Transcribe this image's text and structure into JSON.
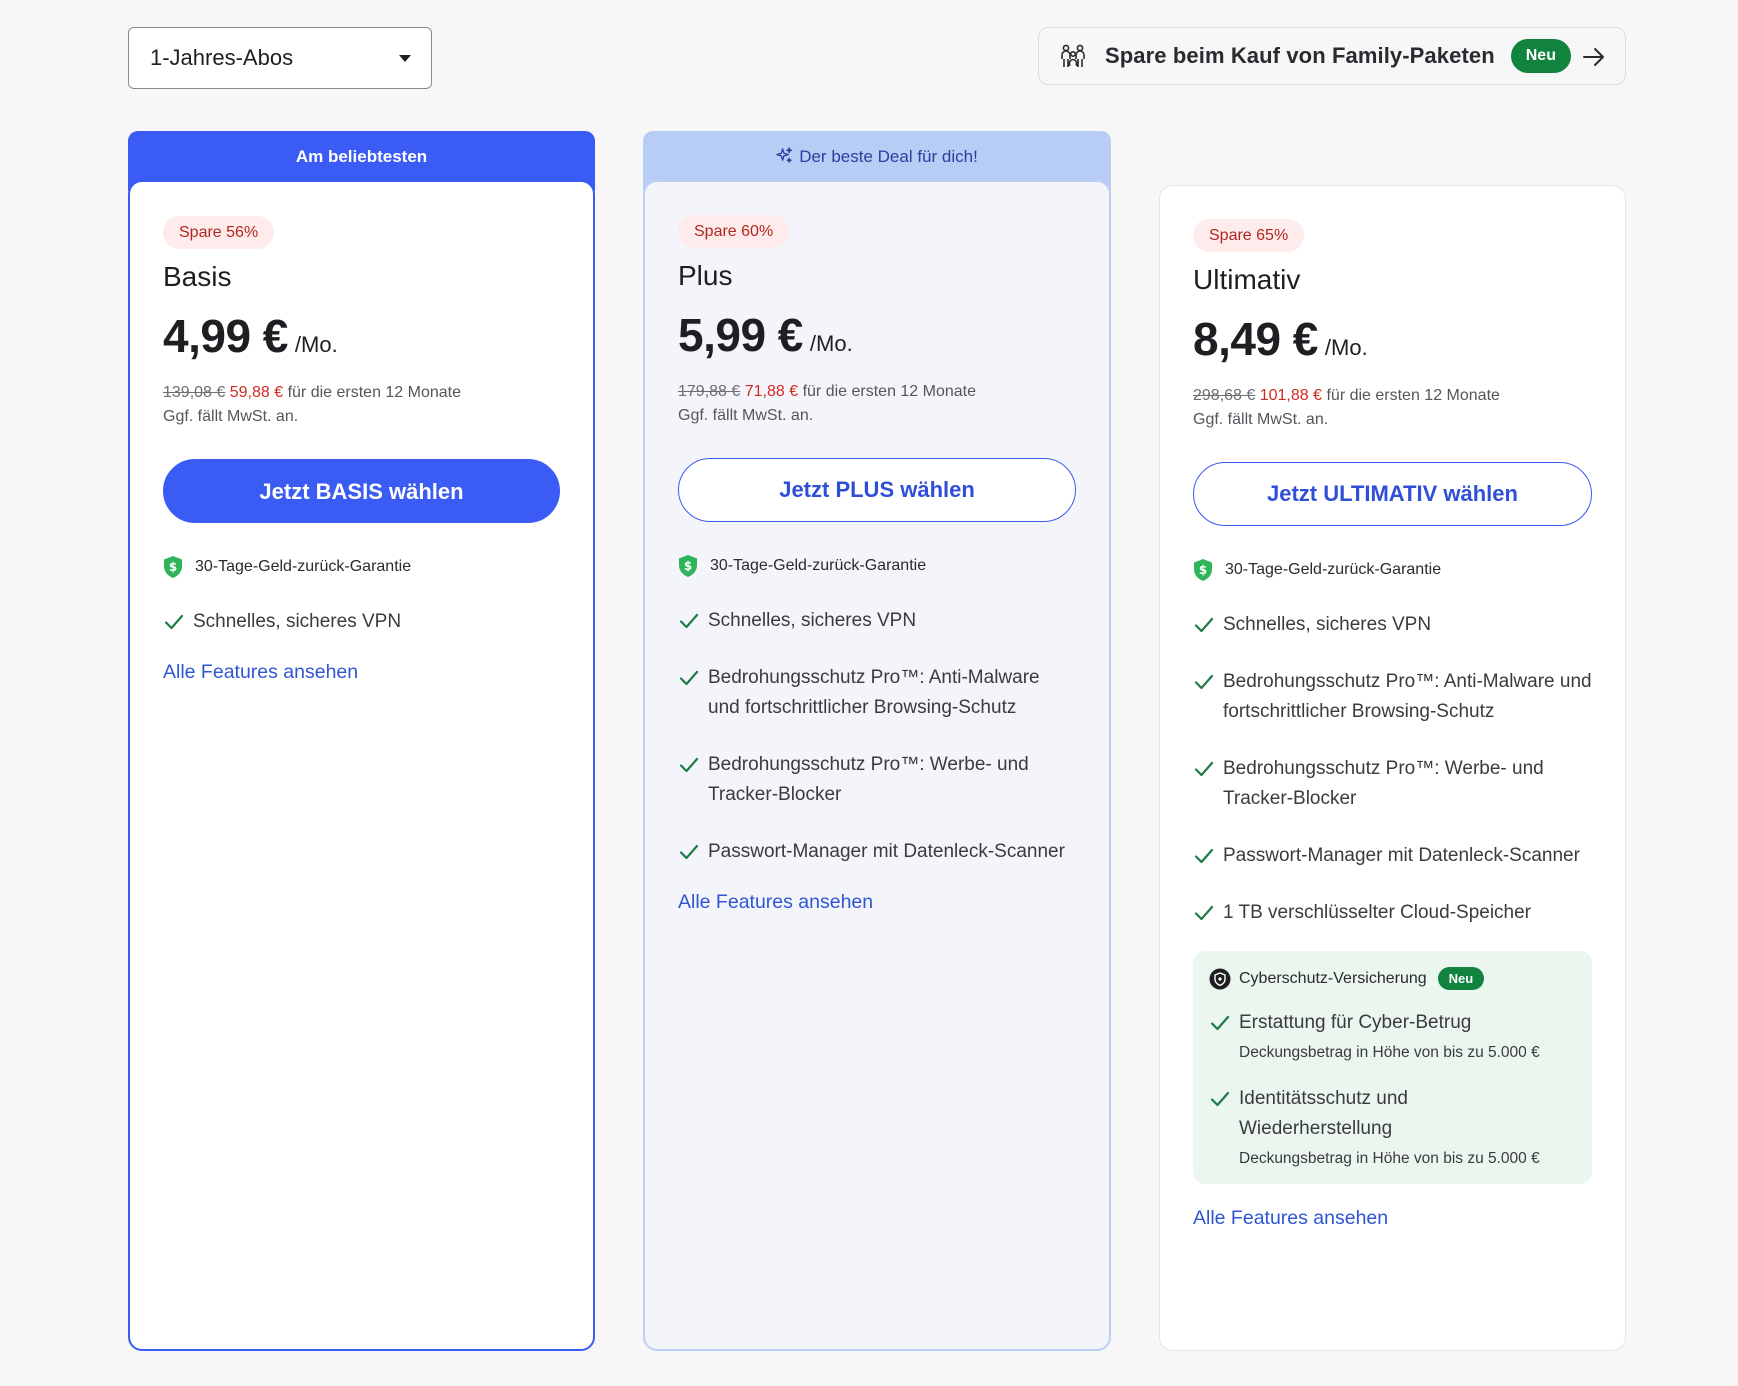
{
  "term_select": {
    "value": "1-Jahres-Abos"
  },
  "family_promo": {
    "text": "Spare beim Kauf von Family-Paketen",
    "badge": "Neu"
  },
  "plans": [
    {
      "banner": "Am beliebtesten",
      "save": "Spare 56%",
      "name": "Basis",
      "price": "4,99 €",
      "per": "/Mo.",
      "old_price": "139,08 €",
      "new_price": "59,88 €",
      "period": "für die ersten 12 Monate",
      "tax": "Ggf. fällt MwSt. an.",
      "cta": "Jetzt BASIS wählen",
      "guarantee": "30-Tage-Geld-zurück-Garantie",
      "features": [
        "Schnelles, sicheres VPN"
      ],
      "link": "Alle Features ansehen"
    },
    {
      "banner": "Der beste Deal für dich!",
      "save": "Spare 60%",
      "name": "Plus",
      "price": "5,99 €",
      "per": "/Mo.",
      "old_price": "179,88 €",
      "new_price": "71,88 €",
      "period": "für die ersten 12 Monate",
      "tax": "Ggf. fällt MwSt. an.",
      "cta": "Jetzt PLUS wählen",
      "guarantee": "30-Tage-Geld-zurück-Garantie",
      "features": [
        "Schnelles, sicheres VPN",
        "Bedrohungsschutz Pro™: Anti-Malware und fortschrittlicher Browsing-Schutz",
        "Bedrohungsschutz Pro™: Werbe- und Tracker-Blocker",
        "Passwort-Manager mit Datenleck-Scanner"
      ],
      "link": "Alle Features ansehen"
    },
    {
      "save": "Spare 65%",
      "name": "Ultimativ",
      "price": "8,49 €",
      "per": "/Mo.",
      "old_price": "298,68 €",
      "new_price": "101,88 €",
      "period": "für die ersten 12 Monate",
      "tax": "Ggf. fällt MwSt. an.",
      "cta": "Jetzt ULTIMATIV wählen",
      "guarantee": "30-Tage-Geld-zurück-Garantie",
      "features": [
        "Schnelles, sicheres VPN",
        "Bedrohungsschutz Pro™: Anti-Malware und fortschrittlicher Browsing-Schutz",
        "Bedrohungsschutz Pro™: Werbe- und Tracker-Blocker",
        "Passwort-Manager mit Datenleck-Scanner",
        "1 TB verschlüsselter Cloud-Speicher"
      ],
      "cyber": {
        "title": "Cyberschutz-Versicherung",
        "badge": "Neu",
        "items": [
          {
            "label": "Erstattung für Cyber-Betrug",
            "sub": "Deckungsbetrag in Höhe von bis zu 5.000 €"
          },
          {
            "label": "Identitätsschutz und Wiederherstellung",
            "sub": "Deckungsbetrag in Höhe von bis zu 5.000 €"
          }
        ]
      },
      "link": "Alle Features ansehen"
    }
  ],
  "colors": {
    "accent": "#3b5bf5",
    "check": "#1e7a46",
    "save_text": "#b3261e",
    "new_price": "#d12b21",
    "new_badge": "#12823f"
  }
}
